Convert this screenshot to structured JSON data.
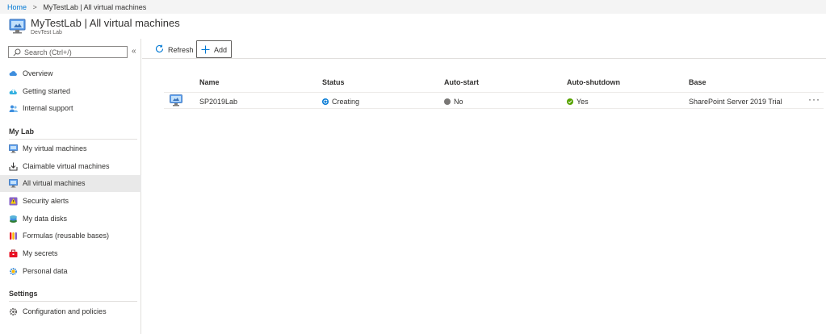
{
  "breadcrumb": {
    "home": "Home",
    "separator": ">",
    "current": "MyTestLab | All virtual machines"
  },
  "header": {
    "title": "MyTestLab | All virtual machines",
    "subtitle": "DevTest Lab"
  },
  "search": {
    "placeholder": "Search (Ctrl+/)"
  },
  "sidebar": {
    "collapse": "«",
    "top_items": [
      {
        "label": "Overview",
        "icon": "cloud-icon"
      },
      {
        "label": "Getting started",
        "icon": "cloud-upload-icon"
      },
      {
        "label": "Internal support",
        "icon": "people-icon"
      }
    ],
    "my_lab_title": "My Lab",
    "my_lab_items": [
      {
        "label": "My virtual machines",
        "icon": "vm-icon"
      },
      {
        "label": "Claimable virtual machines",
        "icon": "download-tray-icon"
      },
      {
        "label": "All virtual machines",
        "icon": "vm-icon",
        "active": true
      },
      {
        "label": "Security alerts",
        "icon": "security-alert-icon"
      },
      {
        "label": "My data disks",
        "icon": "disk-icon"
      },
      {
        "label": "Formulas (reusable bases)",
        "icon": "formula-tubes-icon"
      },
      {
        "label": "My secrets",
        "icon": "briefcase-icon"
      },
      {
        "label": "Personal data",
        "icon": "gear-icon"
      }
    ],
    "settings_title": "Settings",
    "settings_items": [
      {
        "label": "Configuration and policies",
        "icon": "gear-icon"
      }
    ]
  },
  "toolbar": {
    "refresh": "Refresh",
    "add": "Add"
  },
  "table": {
    "columns": [
      "Name",
      "Status",
      "Auto-start",
      "Auto-shutdown",
      "Base"
    ],
    "rows": [
      {
        "name": "SP2019Lab",
        "status": "Creating",
        "auto_start": "No",
        "auto_shutdown": "Yes",
        "base": "SharePoint Server 2019 Trial",
        "more": "···"
      }
    ]
  },
  "colors": {
    "accent": "#0078d4",
    "success": "#57a300",
    "neutral_dot": "#797775",
    "active_bg": "#e9e9e9"
  }
}
